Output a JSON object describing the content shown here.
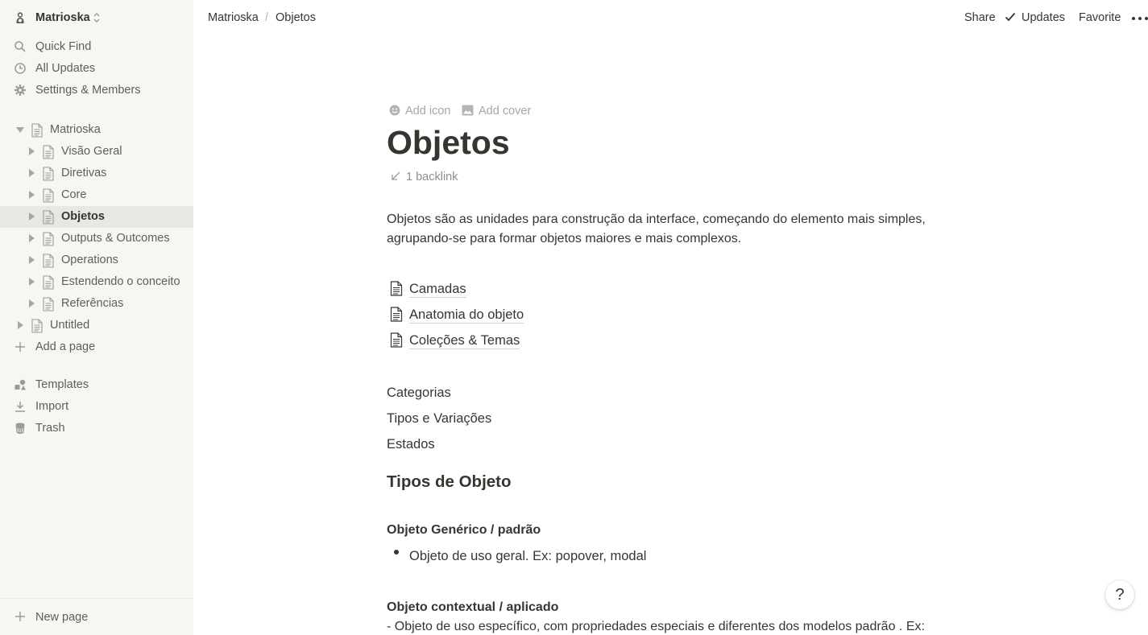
{
  "sidebar": {
    "workspace": "Matrioska",
    "nav": [
      {
        "label": "Quick Find",
        "icon": "search-icon"
      },
      {
        "label": "All Updates",
        "icon": "clock-icon"
      },
      {
        "label": "Settings & Members",
        "icon": "gear-icon"
      }
    ],
    "tree": [
      {
        "label": "Matrioska",
        "level": 0,
        "expanded": true
      },
      {
        "label": "Visão Geral",
        "level": 1
      },
      {
        "label": "Diretivas",
        "level": 1
      },
      {
        "label": "Core",
        "level": 1
      },
      {
        "label": "Objetos",
        "level": 1,
        "active": true
      },
      {
        "label": "Outputs & Outcomes",
        "level": 1
      },
      {
        "label": "Operations",
        "level": 1
      },
      {
        "label": "Estendendo o conceito",
        "level": 1
      },
      {
        "label": "Referências",
        "level": 1
      },
      {
        "label": "Untitled",
        "level": 0
      }
    ],
    "add_page": "Add a page",
    "tools": [
      {
        "label": "Templates",
        "icon": "shapes-icon"
      },
      {
        "label": "Import",
        "icon": "download-icon"
      },
      {
        "label": "Trash",
        "icon": "trash-icon"
      }
    ],
    "new_page": "New page"
  },
  "topbar": {
    "breadcrumb": [
      "Matrioska",
      "Objetos"
    ],
    "breadcrumb_sep": "/",
    "share": "Share",
    "updates": "Updates",
    "favorite": "Favorite"
  },
  "page": {
    "add_icon": "Add icon",
    "add_cover": "Add cover",
    "title": "Objetos",
    "backlinks": "1 backlink",
    "intro_line1": "Objetos são as unidades para construção da interface, começando do elemento mais simples,",
    "intro_line2": "agrupando-se para formar objetos maiores e mais complexos.",
    "subpages": [
      "Camadas",
      "Anatomia do objeto",
      "Coleções & Temas"
    ],
    "plain_items": [
      "Categorias",
      "Tipos e Variações",
      "Estados"
    ],
    "heading": "Tipos de Objeto",
    "section1_title": "Objeto Genérico / padrão",
    "section1_bullet": "Objeto de uso geral. Ex: popover, modal",
    "section2_title": "Objeto contextual / aplicado",
    "section2_text": "- Objeto de uso específico, com propriedades especiais e diferentes dos modelos padrão . Ex:"
  },
  "help": "?"
}
